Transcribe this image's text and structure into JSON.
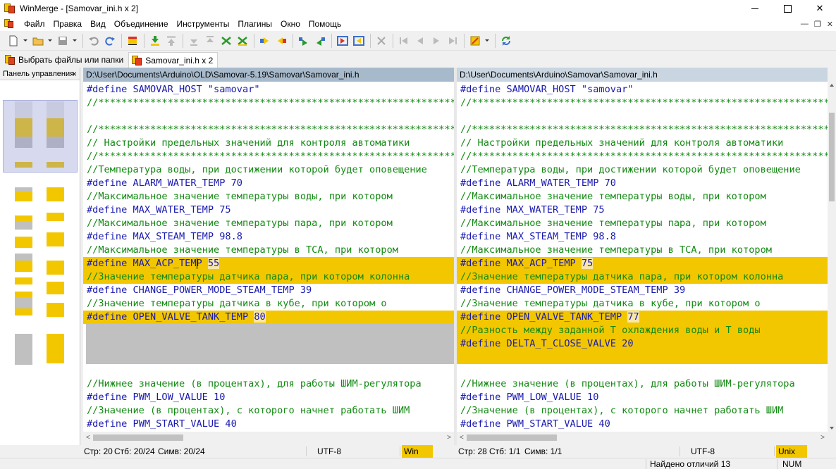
{
  "window": {
    "title": "WinMerge - [Samovar_ini.h x 2]"
  },
  "menu": [
    "Файл",
    "Правка",
    "Вид",
    "Объединение",
    "Инструменты",
    "Плагины",
    "Окно",
    "Помощь"
  ],
  "tabs": [
    {
      "label": "Выбрать файлы или папки",
      "active": false
    },
    {
      "label": "Samovar_ini.h x 2",
      "active": true
    }
  ],
  "location_pane": {
    "title": "Панель управления",
    "close": "×"
  },
  "left": {
    "path": "D:\\User\\Documents\\Arduino\\OLD\\Samovar-5.19\\Samovar\\Samovar_ini.h",
    "lines": [
      "#define SAMOVAR_HOST \"samovar\"",
      "//*******************************************************************************",
      "",
      "//*******************************************************************************",
      "// Настройки предельных значений для контроля автоматики",
      "//*******************************************************************************",
      "//Температура воды, при достижении которой будет оповещение",
      "#define ALARM_WATER_TEMP 70",
      "//Максимальное значение температуры воды, при котором",
      "#define MAX_WATER_TEMP 75",
      "//Максимальное значение температуры пара, при котором",
      "#define MAX_STEAM_TEMP 98.8",
      "//Максимальное значение температуры в ТСА, при котором",
      "#define MAX_ACP_TEMP 55",
      "//Значение температуры датчика пара, при котором колонна",
      "#define CHANGE_POWER_MODE_STEAM_TEMP 39",
      "//Значение температуры датчика в кубе, при котором о",
      "#define OPEN_VALVE_TANK_TEMP 80",
      "",
      "",
      "",
      "",
      "//Нижнее значение (в процентах), для работы ШИМ-регулятора",
      "#define PWM_LOW_VALUE 10",
      "//Значение (в процентах), с которого начнет работать ШИМ",
      "#define PWM_START_VALUE 40"
    ],
    "status": {
      "line": "Стр: 20",
      "col": "Стб: 20/24",
      "chars": "Симв: 20/24",
      "encoding": "UTF-8",
      "eol": "Win"
    }
  },
  "right": {
    "path": "D:\\User\\Documents\\Arduino\\Samovar\\Samovar_ini.h",
    "lines": [
      "#define SAMOVAR_HOST \"samovar\"",
      "//*******************************************************************************",
      "",
      "//*******************************************************************************",
      "// Настройки предельных значений для контроля автоматики",
      "//*******************************************************************************",
      "//Температура воды, при достижении которой будет оповещение",
      "#define ALARM_WATER_TEMP 70",
      "//Максимальное значение температуры воды, при котором",
      "#define MAX_WATER_TEMP 75",
      "//Максимальное значение температуры пара, при котором",
      "#define MAX_STEAM_TEMP 98.8",
      "//Максимальное значение температуры в ТСА, при котором",
      "#define MAX_ACP_TEMP 75",
      "//Значение температуры датчика пара, при котором колонна",
      "#define CHANGE_POWER_MODE_STEAM_TEMP 39",
      "//Значение температуры датчика в кубе, при котором о",
      "#define OPEN_VALVE_TANK_TEMP 77",
      "//Разность между заданной Т охлаждения воды и Т воды",
      "#define DELTA_T_CLOSE_VALVE 20",
      "",
      "",
      "//Нижнее значение (в процентах), для работы ШИМ-регулятора",
      "#define PWM_LOW_VALUE 10",
      "//Значение (в процентах), с которого начнет работать ШИМ",
      "#define PWM_START_VALUE 40"
    ],
    "status": {
      "line": "Стр: 28",
      "col": "Стб: 1/1",
      "chars": "Симв: 1/1",
      "encoding": "UTF-8",
      "eol": "Unix"
    }
  },
  "status": {
    "differences": "Найдено отличий 13",
    "numlock": "NUM"
  },
  "colors": {
    "diff": "#f2c700",
    "diff_changed_word": "#f8e7a8",
    "gap": "#c0c0c0",
    "define": "#1a1ab0",
    "comment": "#138a13"
  }
}
